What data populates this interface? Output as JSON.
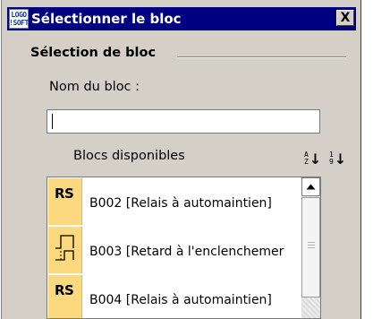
{
  "window": {
    "title": "Sélectionner le bloc",
    "icon_text_top": "LOGO",
    "icon_text_bottom": "!SOFT",
    "close_label": "X"
  },
  "group": {
    "title": "Sélection de bloc"
  },
  "name_field": {
    "label": "Nom du bloc :",
    "value": ""
  },
  "available": {
    "label": "Blocs disponibles",
    "sort_alpha": {
      "top": "A",
      "bottom": "Z",
      "arrow": "↓",
      "icon": "sort-alpha-icon"
    },
    "sort_numeric": {
      "top": "1",
      "bottom": "9",
      "arrow": "↓",
      "icon": "sort-numeric-icon"
    }
  },
  "blocks": [
    {
      "icon": "RS",
      "icon_name": "rs-relay-icon",
      "label": "B002 [Relais à automaintien]"
    },
    {
      "icon": "",
      "icon_name": "on-delay-icon",
      "label": "B003 [Retard à l'enclenchemer"
    },
    {
      "icon": "RS",
      "icon_name": "rs-relay-icon",
      "label": "B004 [Relais à automaintien]"
    }
  ],
  "colors": {
    "titlebar": "#000080",
    "window_bg": "#d4d0c8",
    "icon_bg": "#fcd97f"
  }
}
